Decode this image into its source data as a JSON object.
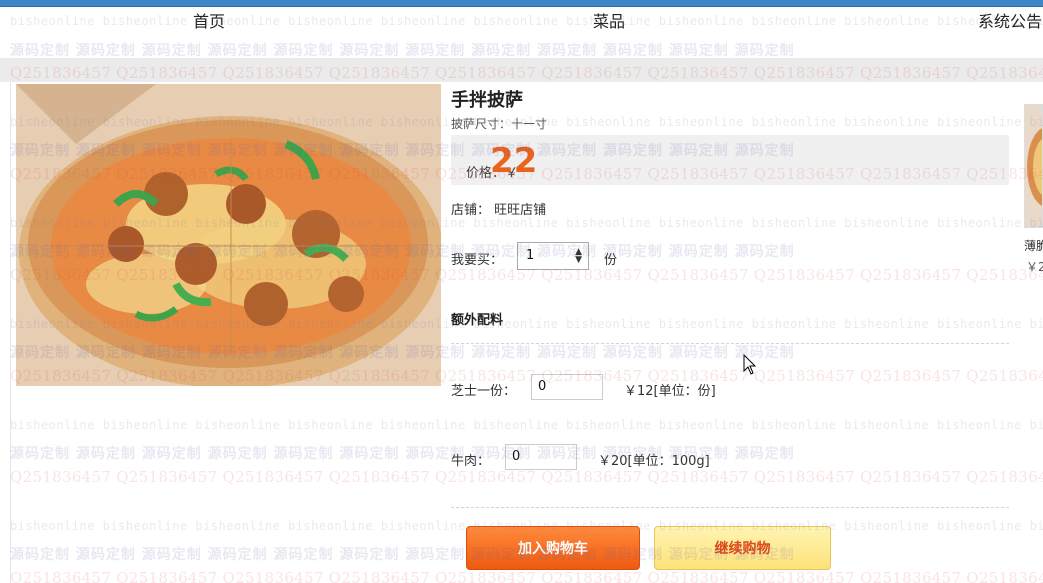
{
  "nav": {
    "items": [
      {
        "label": "首页"
      },
      {
        "label": "菜品"
      },
      {
        "label": "系统公告"
      }
    ]
  },
  "product": {
    "title": "手拌披萨",
    "size_label": "披萨尺寸：十一寸",
    "price_label": "价格：￥",
    "price_value": "22",
    "shop_label": "店铺：",
    "shop_name": "旺旺店铺",
    "quantity_label": "我要买：",
    "quantity_value": "1",
    "quantity_unit": "份"
  },
  "extras": {
    "heading": "额外配料",
    "items": [
      {
        "label": "芝士一份：",
        "value": "0",
        "price_text": "￥12[单位：份]"
      },
      {
        "label": "牛肉：",
        "value": "0",
        "price_text": "￥20[单位：100g]"
      }
    ]
  },
  "actions": {
    "add_to_cart": "加入购物车",
    "continue_shopping": "继续购物"
  },
  "sidebar": {
    "item_name": "薄脆",
    "item_price": "￥2"
  },
  "watermark": {
    "text_a": "bisheonline",
    "text_b": "源码定制",
    "text_c": "Q2518364​57"
  },
  "colors": {
    "accent_orange": "#e9641d",
    "nav_blue": "#3a86c8",
    "continue_yellow": "#fde27a"
  }
}
